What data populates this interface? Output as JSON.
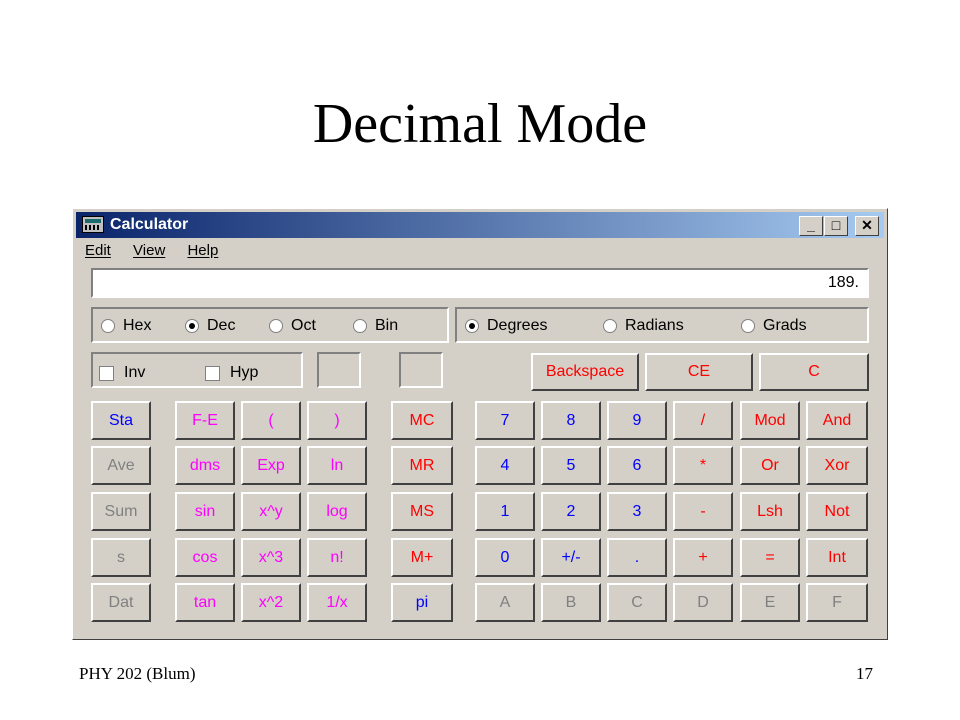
{
  "slide": {
    "title": "Decimal Mode",
    "footer_left": "PHY 202 (Blum)",
    "footer_right": "17"
  },
  "window": {
    "title": "Calculator",
    "icon": "calculator-icon",
    "controls": {
      "minimize": "_",
      "maximize": "□",
      "close": "✕"
    }
  },
  "menu": [
    "Edit",
    "View",
    "Help"
  ],
  "display": {
    "value": "189."
  },
  "number_base": {
    "options": [
      "Hex",
      "Dec",
      "Oct",
      "Bin"
    ],
    "selected": "Dec"
  },
  "angle_units": {
    "options": [
      "Degrees",
      "Radians",
      "Grads"
    ],
    "selected": "Degrees"
  },
  "checkboxes": [
    "Inv",
    "Hyp"
  ],
  "edit_buttons": [
    "Backspace",
    "CE",
    "C"
  ],
  "stat_buttons": [
    "Sta",
    "Ave",
    "Sum",
    "s",
    "Dat"
  ],
  "sci_buttons": [
    [
      "F-E",
      "(",
      ")"
    ],
    [
      "dms",
      "Exp",
      "ln"
    ],
    [
      "sin",
      "x^y",
      "log"
    ],
    [
      "cos",
      "x^3",
      "n!"
    ],
    [
      "tan",
      "x^2",
      "1/x"
    ]
  ],
  "memory_buttons": [
    "MC",
    "MR",
    "MS",
    "M+",
    "pi"
  ],
  "digit_buttons": [
    [
      "7",
      "8",
      "9",
      "/",
      "Mod",
      "And"
    ],
    [
      "4",
      "5",
      "6",
      "*",
      "Or",
      "Xor"
    ],
    [
      "1",
      "2",
      "3",
      "-",
      "Lsh",
      "Not"
    ],
    [
      "0",
      "+/-",
      ".",
      "+",
      "=",
      "Int"
    ],
    [
      "A",
      "B",
      "C",
      "D",
      "E",
      "F"
    ]
  ],
  "colors": {
    "blue": "#0000ff",
    "red": "#ff0000",
    "magenta": "#ff00ff",
    "disabled": "#808080",
    "face": "#d4d0c8"
  }
}
